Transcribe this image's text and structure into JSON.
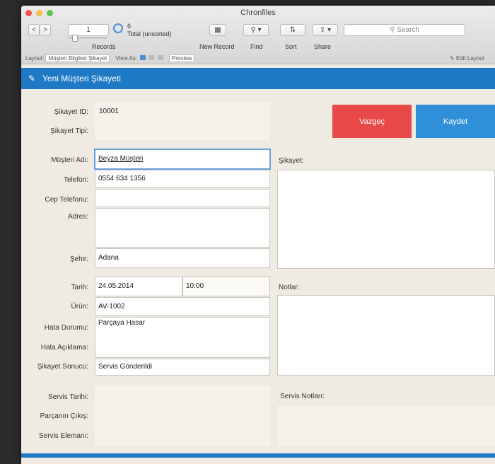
{
  "window": {
    "title": "Chronfiles"
  },
  "toolbar": {
    "nav_prev": "<",
    "nav_next": ">",
    "record_counter": "1",
    "record_total": "6",
    "record_total_label": "Total (unsorted)",
    "records_label": "Records",
    "new_record_label": "New Record",
    "find_label": "Find",
    "sort_label": "Sort",
    "share_label": "Share",
    "search_placeholder": "Search"
  },
  "layoutbar": {
    "layout_label": "Layout:",
    "layout_value": "Müşteri Bilgileri Şikayet",
    "view_as_label": "View As:",
    "preview_label": "Preview",
    "edit_layout_label": "Edit Layout"
  },
  "header": {
    "title": "Yeni Müşteri Şikayeti"
  },
  "form": {
    "sikayet_id_label": "Şikayet ID:",
    "sikayet_id_value": "10001",
    "sikayet_tipi_label": "Şikayet Tipi:",
    "musteri_adi_label": "Müşteri Adı:",
    "musteri_adi_value": "Beyza Müşteri",
    "telefon_label": "Telefon:",
    "telefon_value": "0554 634 1356",
    "cep_telefonu_label": "Cep Telefonu:",
    "adres_label": "Adres:",
    "sehir_label": "Şehir:",
    "sehir_value": "Adana",
    "tarih_label": "Tarih:",
    "tarih_value": "24.05.2014",
    "saat_value": "10:00",
    "urun_label": "Ürün:",
    "urun_value": "AV-1002",
    "hata_durumu_label": "Hata Durumu:",
    "hata_durumu_value": "Parçaya Hasar",
    "hata_aciklama_label": "Hata Açıklama:",
    "sikayet_sonucu_label": "Şikayet Sonucu:",
    "sikayet_sonucu_value": "Servis Gönderildi",
    "servis_tarihi_label": "Servis Tarihi:",
    "parca_cikis_label": "Parçanın Çıkış:",
    "servis_elemani_label": "Servis Elemanı:",
    "sikayet_panel_label": "Şikayet:",
    "notlar_label": "Notlar:",
    "servis_notlari_label": "Servis Notları:",
    "button_vazgec": "Vazgeç",
    "button_kaydet": "Kaydet"
  },
  "colors": {
    "accent_blue": "#1f7ac5",
    "cancel_red": "#e84848",
    "save_blue": "#2f8fd8"
  }
}
